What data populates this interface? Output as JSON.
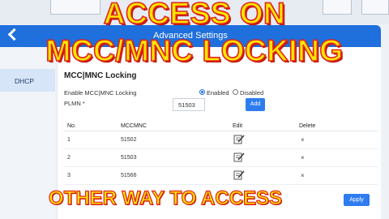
{
  "overlay": {
    "line1": "ACCESS ON",
    "line2": "MCC/MNC LOCKING",
    "bottom": "OTHER WAY TO ACCESS"
  },
  "header": {
    "title": "Advanced Settings",
    "back_icon": "chevron-left-icon"
  },
  "sidebar": {
    "items": [
      {
        "label": "DHCP",
        "selected": true
      }
    ]
  },
  "section": {
    "title": "MCC|MNC Locking",
    "enable_label": "Enable MCC|MNC Locking",
    "radio_enabled": "Enabled",
    "radio_disabled": "Disabled",
    "enabled_selected": true,
    "plmn_label": "PLMN *",
    "plmn_value": "51503",
    "add_button": "Add"
  },
  "table": {
    "headers": [
      "No.",
      "MCCMNC",
      "Edit",
      "Delete"
    ],
    "rows": [
      {
        "no": "1",
        "mccmnc": "51502",
        "delete": "×"
      },
      {
        "no": "2",
        "mccmnc": "51503",
        "delete": "×"
      },
      {
        "no": "3",
        "mccmnc": "51566",
        "delete": "×"
      }
    ]
  },
  "apply_button": "Apply",
  "colors": {
    "header_bg": "#1f6fdc",
    "button_bg": "#2e7cf0",
    "overlay_text": "#ffe600",
    "overlay_outline": "#e0261b"
  }
}
